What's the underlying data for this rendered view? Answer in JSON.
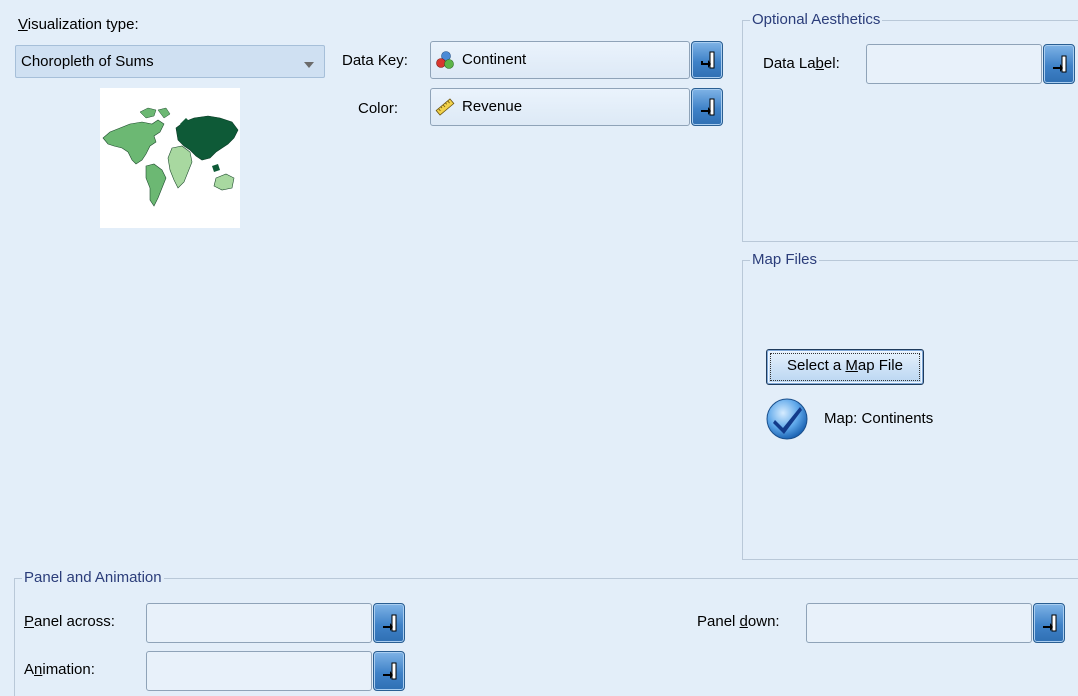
{
  "visualization": {
    "label": "Visualization type:",
    "underline_char": "V",
    "selected": "Choropleth of Sums",
    "preview_icon": "world-map-choropleth-icon"
  },
  "data_key": {
    "label": "Data Key:",
    "value": "Continent",
    "icon": "nominal-measure-icon"
  },
  "color": {
    "label": "Color:",
    "value": "Revenue",
    "icon": "scale-measure-ruler-icon"
  },
  "optional_aesthetics": {
    "title": "Optional Aesthetics",
    "data_label": {
      "label_pre": "Data La",
      "label_u": "b",
      "label_post": "el:",
      "value": ""
    }
  },
  "map_files": {
    "title": "Map Files",
    "button_pre": "Select a ",
    "button_u": "M",
    "button_post": "ap File",
    "status_icon": "checkmark-icon",
    "status_text": "Map: Continents"
  },
  "panel_animation": {
    "title": "Panel and Animation",
    "panel_across": {
      "label_u": "P",
      "label_post": "anel across:",
      "value": ""
    },
    "panel_down": {
      "label_pre": "Panel ",
      "label_u": "d",
      "label_post": "own:",
      "value": ""
    },
    "animation": {
      "label_pre": "A",
      "label_u": "n",
      "label_post": "imation:",
      "value": ""
    }
  },
  "colors": {
    "background": "#e3eef9",
    "legend_text": "#2b3d7a",
    "selector_button": "#3f82c8",
    "map_dark": "#0e5a37",
    "map_mid": "#6cb873",
    "map_light": "#a8d8a0"
  }
}
